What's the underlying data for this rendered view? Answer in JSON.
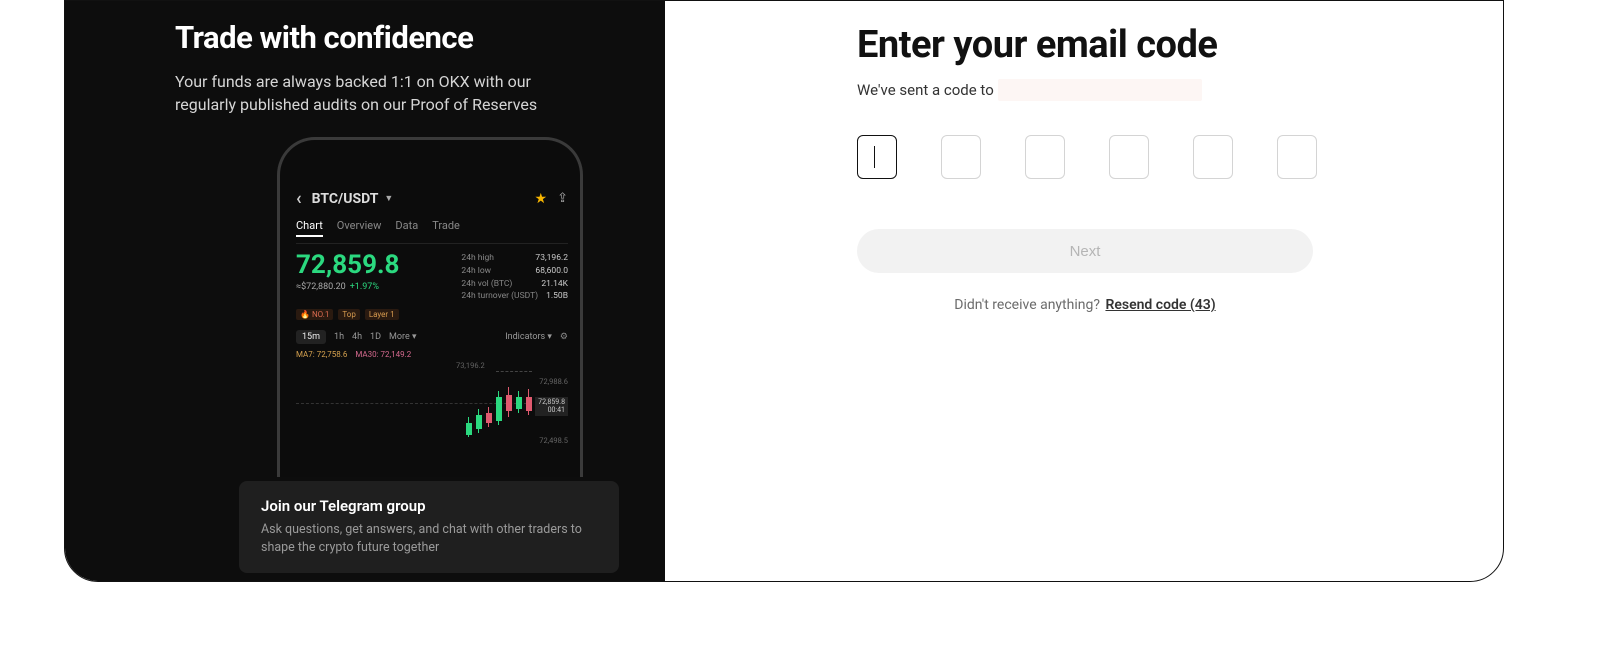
{
  "left": {
    "title": "Trade with confidence",
    "subtitle": "Your funds are always backed 1:1 on OKX with our regularly published audits on our Proof of Reserves",
    "phone": {
      "pair": "BTC/USDT",
      "tabs": [
        "Chart",
        "Overview",
        "Data",
        "Trade"
      ],
      "active_tab": 0,
      "price": "72,859.8",
      "price_sub": "≈$72,880.20",
      "price_change": "+1.97%",
      "stats": [
        {
          "label": "24h high",
          "value": "73,196.2"
        },
        {
          "label": "24h low",
          "value": "68,600.0"
        },
        {
          "label": "24h vol (BTC)",
          "value": "21.14K"
        },
        {
          "label": "24h turnover (USDT)",
          "value": "1.50B"
        }
      ],
      "badges": [
        "NO.1",
        "Top",
        "Layer 1"
      ],
      "timeframes": [
        "15m",
        "1h",
        "4h",
        "1D"
      ],
      "tf_active": 0,
      "tf_more": "More ▾",
      "tf_indicators": "Indicators ▾",
      "ma": {
        "ma7_label": "MA7:",
        "ma7": "72,758.6",
        "ma30_label": "MA30:",
        "ma30": "72,149.2"
      },
      "chart_labels": {
        "top_val": "73,196.2",
        "right1": "72,988.6",
        "price_box_1": "72,859.8",
        "price_box_2": "00:41",
        "bottom": "72,498.5"
      }
    },
    "telegram": {
      "title": "Join our Telegram group",
      "sub": "Ask questions, get answers, and chat with other traders to shape the crypto future together"
    }
  },
  "right": {
    "title": "Enter your email code",
    "sub_prefix": "We've sent a code to",
    "next": "Next",
    "resend_prefix": "Didn't receive anything?",
    "resend_link": "Resend code (43)"
  }
}
